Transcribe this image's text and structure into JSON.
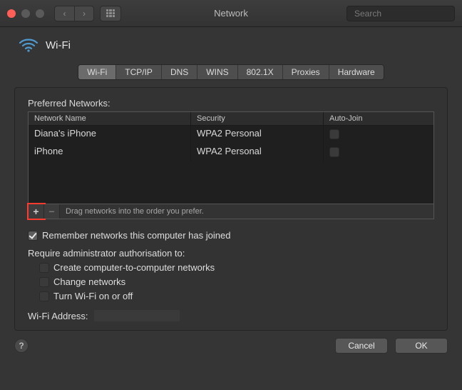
{
  "window": {
    "title": "Network",
    "search_placeholder": "Search"
  },
  "header": {
    "interface_label": "Wi-Fi"
  },
  "tabs": [
    {
      "label": "Wi-Fi",
      "active": true
    },
    {
      "label": "TCP/IP"
    },
    {
      "label": "DNS"
    },
    {
      "label": "WINS"
    },
    {
      "label": "802.1X"
    },
    {
      "label": "Proxies"
    },
    {
      "label": "Hardware"
    }
  ],
  "preferred_networks": {
    "section_label": "Preferred Networks:",
    "columns": {
      "name": "Network Name",
      "security": "Security",
      "autojoin": "Auto-Join"
    },
    "rows": [
      {
        "name": "Diana's iPhone",
        "security": "WPA2 Personal",
        "autojoin": false
      },
      {
        "name": "iPhone",
        "security": "WPA2 Personal",
        "autojoin": false
      }
    ],
    "drag_hint": "Drag networks into the order you prefer."
  },
  "options": {
    "remember": "Remember networks this computer has joined",
    "require_label": "Require administrator authorisation to:",
    "require_items": [
      "Create computer-to-computer networks",
      "Change networks",
      "Turn Wi-Fi on or off"
    ],
    "wifi_address_label": "Wi-Fi Address:"
  },
  "footer": {
    "cancel": "Cancel",
    "ok": "OK",
    "help_glyph": "?"
  },
  "glyphs": {
    "back": "‹",
    "forward": "›",
    "plus": "+",
    "minus": "−"
  }
}
